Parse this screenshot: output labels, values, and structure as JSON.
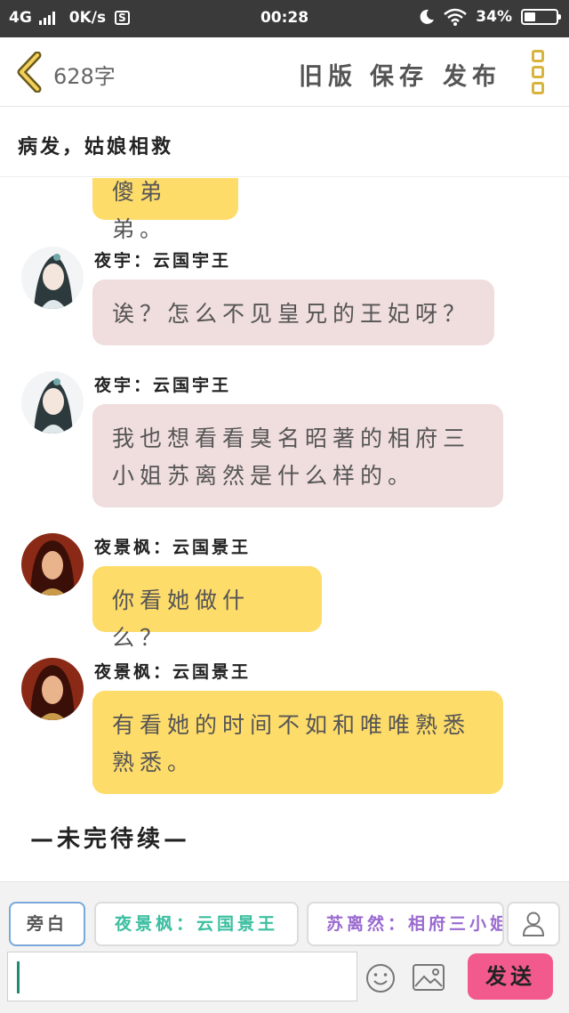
{
  "status_bar": {
    "network": "4G",
    "speed": "0K/s",
    "s_badge": "S",
    "time": "00:28",
    "battery": "34%",
    "battery_level": 0.34
  },
  "header": {
    "word_count": "628字",
    "old_version": "旧版",
    "save": "保存",
    "publish": "发布"
  },
  "title": "病发，姑娘相救",
  "colors": {
    "yellow_bubble": "#fedc6a",
    "pink_bubble": "#f0dddd",
    "send_button": "#f25a8e",
    "accent_gold": "#d9b43d"
  },
  "messages": [
    {
      "speaker": "",
      "text": "傻弟弟。",
      "style": "yellow",
      "avatar": "male-red-avatar"
    },
    {
      "speaker": "夜宇：云国宇王",
      "text": "诶？怎么不见皇兄的王妃呀？",
      "style": "pink",
      "avatar": "male-white-avatar"
    },
    {
      "speaker": "夜宇：云国宇王",
      "text": "我也想看看臭名昭著的相府三小姐苏离然是什么样的。",
      "style": "pink",
      "avatar": "male-white-avatar"
    },
    {
      "speaker": "夜景枫：云国景王",
      "text": "你看她做什么？",
      "style": "yellow",
      "avatar": "male-red-avatar"
    },
    {
      "speaker": "夜景枫：云国景王",
      "text": "有看她的时间不如和唯唯熟悉熟悉。",
      "style": "yellow",
      "avatar": "male-red-avatar"
    }
  ],
  "to_be_continued": "—未完待续—",
  "bottom": {
    "roles": [
      {
        "label": "旁白",
        "color": "#555555"
      },
      {
        "label": "夜景枫：云国景王",
        "color": "#3bbfa0"
      },
      {
        "label": "苏离然：相府三小姐",
        "color": "#9a6ad0"
      }
    ],
    "send_label": "发送",
    "input_value": ""
  }
}
